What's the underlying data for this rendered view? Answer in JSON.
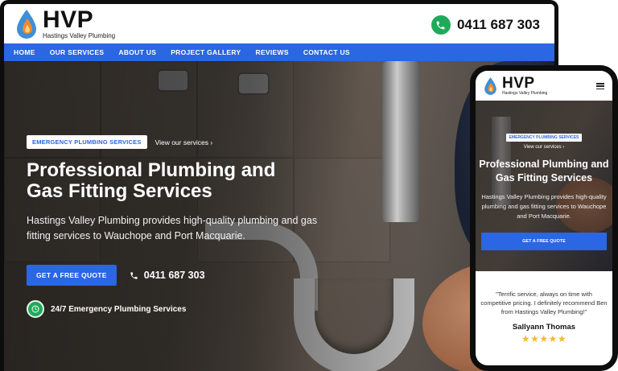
{
  "brand": {
    "logo_main": "HVP",
    "logo_sub": "Hastings Valley Plumbing",
    "colors": {
      "accent": "#2b66e3",
      "phone_green": "#1faa5a",
      "drop_blue": "#3e8fd6",
      "drop_orange": "#f28a2b",
      "stars": "#f5b82e"
    }
  },
  "header": {
    "phone_icon": "phone-icon",
    "phone": "0411 687 303"
  },
  "nav": {
    "items": [
      {
        "label": "HOME"
      },
      {
        "label": "OUR SERVICES"
      },
      {
        "label": "ABOUT US"
      },
      {
        "label": "PROJECT GALLERY"
      },
      {
        "label": "REVIEWS"
      },
      {
        "label": "CONTACT US"
      }
    ]
  },
  "hero": {
    "tag": "EMERGENCY PLUMBING SERVICES",
    "view_link": "View our services ›",
    "title": "Professional Plumbing and Gas Fitting Services",
    "description": "Hastings Valley Plumbing provides high-quality plumbing and gas fitting services to Wauchope and Port Macquarie.",
    "cta": "GET A FREE QUOTE",
    "phone": "0411 687 303",
    "emergency": "24/7 Emergency Plumbing Services"
  },
  "mobile": {
    "menu_icon": "hamburger-menu-icon",
    "hero": {
      "tag": "EMERGENCY PLUMBING SERVICES",
      "view_link": "View our services ›",
      "title": "Professional Plumbing and Gas Fitting Services",
      "description": "Hastings Valley Plumbing provides high-quality plumbing and gas fitting services to Wauchope and Port Macquarie.",
      "cta": "GET A FREE QUOTE"
    },
    "review": {
      "quote": "\"Terrific service, always on time with competitive pricing. I definitely recommend Ben from Hastings Valley Plumbing!\"",
      "reviewer": "Sallyann Thomas",
      "stars": "★★★★★",
      "rating": 5
    }
  }
}
